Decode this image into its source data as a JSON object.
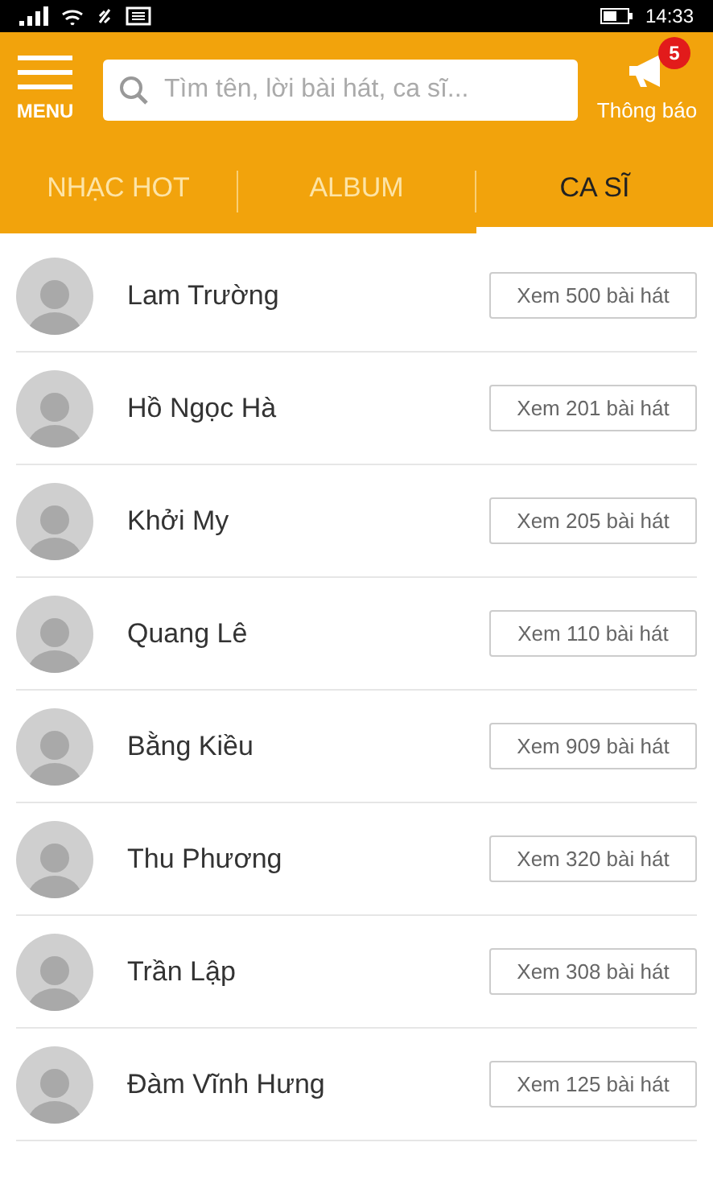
{
  "status_bar": {
    "time": "14:33"
  },
  "header": {
    "menu_label": "MENU",
    "search": {
      "placeholder": "Tìm tên, lời bài hát, ca sĩ..."
    },
    "notifications": {
      "label": "Thông báo",
      "count": "5"
    }
  },
  "tabs": [
    {
      "label": "NHẠC HOT",
      "selected": false
    },
    {
      "label": "ALBUM",
      "selected": false
    },
    {
      "label": "CA SĨ",
      "selected": true
    }
  ],
  "singers": [
    {
      "name": "Lam Trường",
      "button": "Xem 500 bài hát"
    },
    {
      "name": "Hồ Ngọc Hà",
      "button": "Xem 201 bài hát"
    },
    {
      "name": "Khởi My",
      "button": "Xem 205 bài hát"
    },
    {
      "name": "Quang Lê",
      "button": "Xem 110 bài hát"
    },
    {
      "name": "Bằng Kiều",
      "button": "Xem 909 bài hát"
    },
    {
      "name": "Thu Phương",
      "button": "Xem 320 bài hát"
    },
    {
      "name": "Trần Lập",
      "button": "Xem 308 bài hát"
    },
    {
      "name": "Đàm Vĩnh Hưng",
      "button": "Xem 125 bài hát"
    }
  ]
}
